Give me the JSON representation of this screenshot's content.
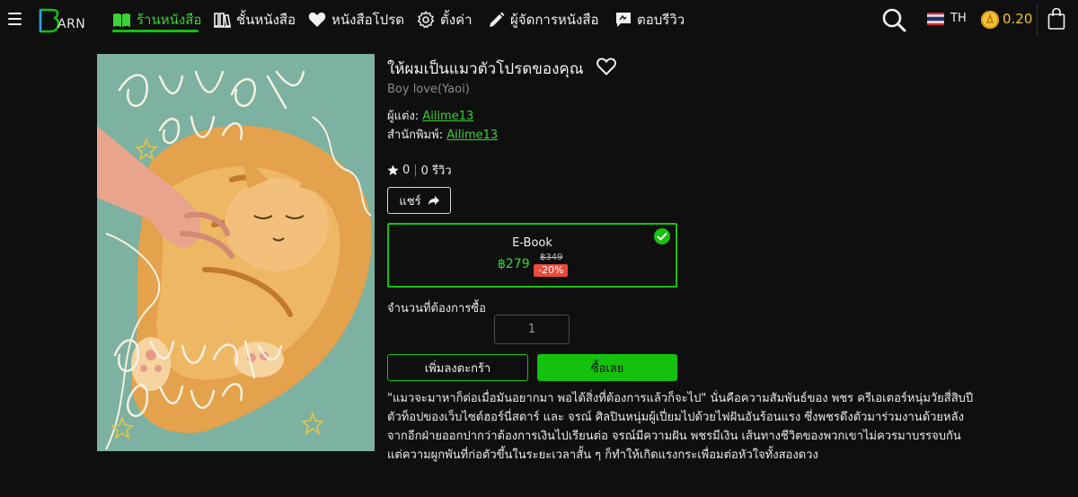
{
  "nav": {
    "logo_text": "ARN",
    "items": [
      {
        "label": "ร้านหนังสือ",
        "active": true
      },
      {
        "label": "ชั้นหนังสือ",
        "active": false
      },
      {
        "label": "หนังสือโปรด",
        "active": false
      },
      {
        "label": "ตั้งค่า",
        "active": false
      },
      {
        "label": "ผู้จัดการหนังสือ",
        "active": false
      },
      {
        "label": "ตอบรีวิว",
        "active": false
      }
    ],
    "language": "TH",
    "coins": "0.20",
    "colors": {
      "accent": "#13c20f",
      "coin": "#f4c23a"
    }
  },
  "book": {
    "title": "ให้ผมเป็นแมวตัวโปรดของคุณ",
    "genre": "Boy love(Yaoi)",
    "author_label": "ผู้แต่ง:",
    "author": "Ailime13",
    "publisher_label": "สำนักพิมพ์:",
    "publisher": "Ailime13",
    "rating": "0",
    "reviews": "0 รีวิว",
    "share_label": "แชร์",
    "format": {
      "name": "E-Book",
      "price": "฿279",
      "old_price": "฿349",
      "discount": "-20%"
    },
    "qty_label": "จำนวนที่ต้องการซื้อ",
    "qty_value": "1",
    "add_to_cart": "เพิ่มลงตะกร้า",
    "buy_now": "ซื้อเลย",
    "description": [
      "\"แมวจะมาหาก็ต่อเมื่อมันอยากมา พอได้สิ่งที่ต้องการแล้วก็จะไป\" นั่นคือความสัมพันธ์ของ พชร ครีเอเตอร์หนุ่มวัยสี่สิบปี",
      "ตัวท็อปของเว็บไซต์ฮอร์นี่สตาร์ และ จรณ์ ศิลปินหนุ่มผู้เปี่ยมไปด้วยไฟฝันอันร้อนแรง ซึ่งพชรดึงตัวมาร่วมงานด้วยหลัง",
      "จากอีกฝ่ายออกปากว่าต้องการเงินไปเรียนต่อ จรณ์มีความฝัน พชรมีเงิน เส้นทางชีวิตของพวกเขาไม่ควรมาบรรจบกัน",
      "แต่ความผูกพันที่ก่อตัวขึ้นในระยะเวลาสั้น ๆ ก็ทำให้เกิดแรงกระเพื่อมต่อหัวใจทั้งสองดวง"
    ]
  }
}
